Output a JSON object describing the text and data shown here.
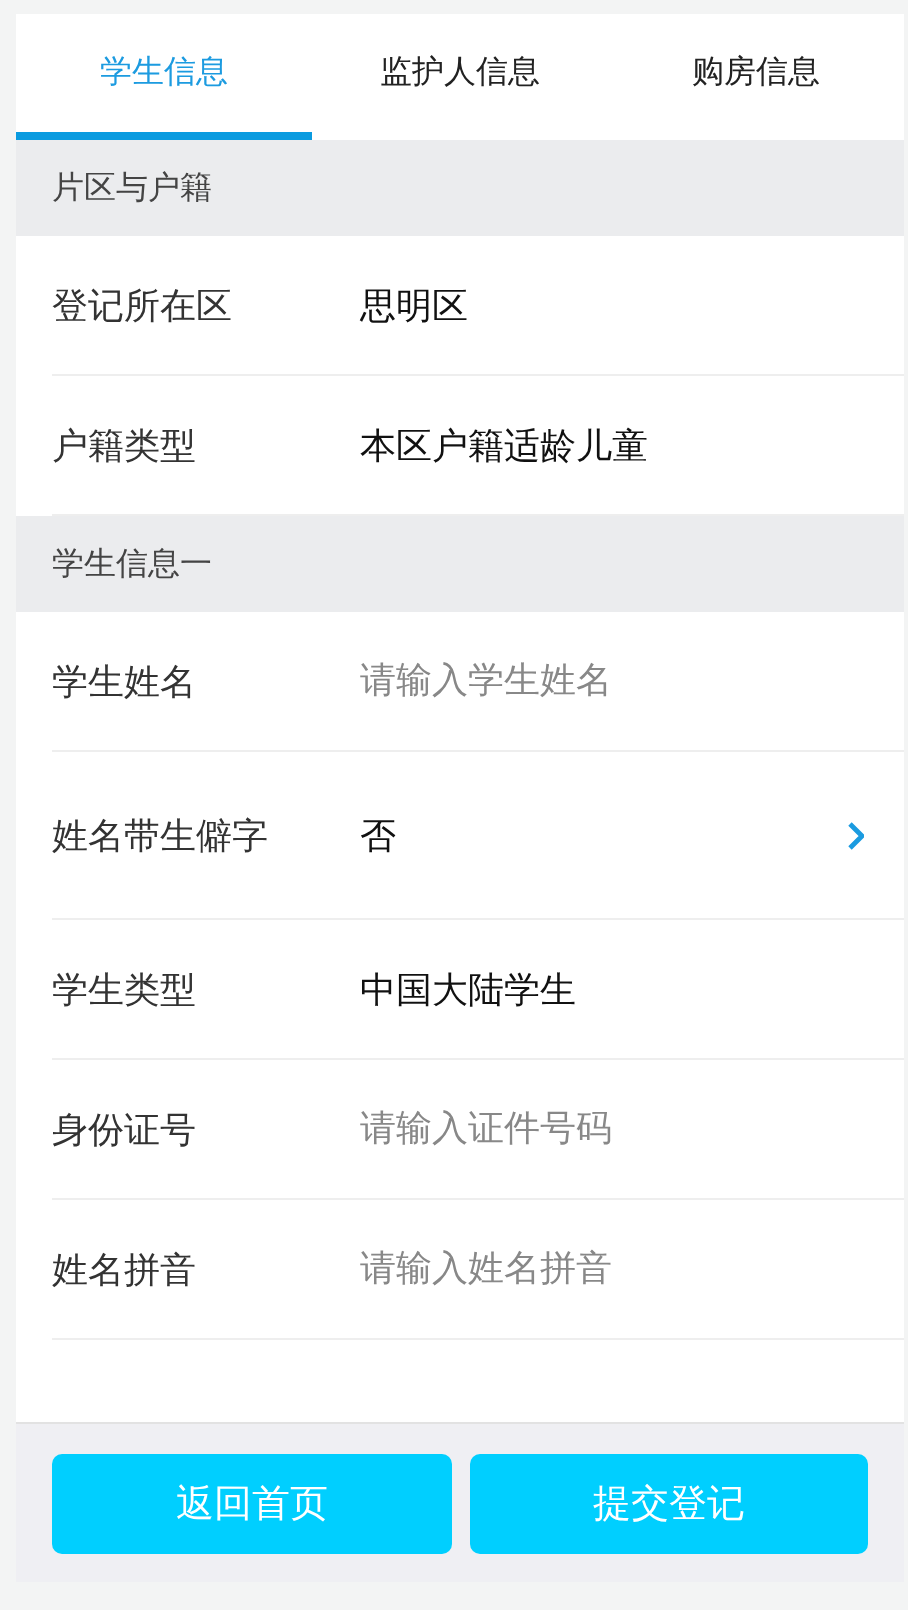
{
  "tabs": [
    {
      "label": "学生信息",
      "selected": true
    },
    {
      "label": "监护人信息",
      "selected": false
    },
    {
      "label": "购房信息",
      "selected": false
    }
  ],
  "sections": [
    {
      "title": "片区与户籍",
      "rows": [
        {
          "kind": "value",
          "label": "登记所在区",
          "value": "思明区"
        },
        {
          "kind": "value",
          "label": "户籍类型",
          "value": "本区户籍适龄儿童"
        }
      ]
    },
    {
      "title": "学生信息一",
      "rows": [
        {
          "kind": "input",
          "label": "学生姓名",
          "placeholder": "请输入学生姓名"
        },
        {
          "kind": "select",
          "label": "姓名带生僻字",
          "value": "否"
        },
        {
          "kind": "value",
          "label": "学生类型",
          "value": "中国大陆学生"
        },
        {
          "kind": "input",
          "label": "身份证号",
          "placeholder": "请输入证件号码"
        },
        {
          "kind": "input",
          "label": "姓名拼音",
          "placeholder": "请输入姓名拼音"
        }
      ]
    }
  ],
  "buttons": [
    "返回首页",
    "提交登记"
  ]
}
